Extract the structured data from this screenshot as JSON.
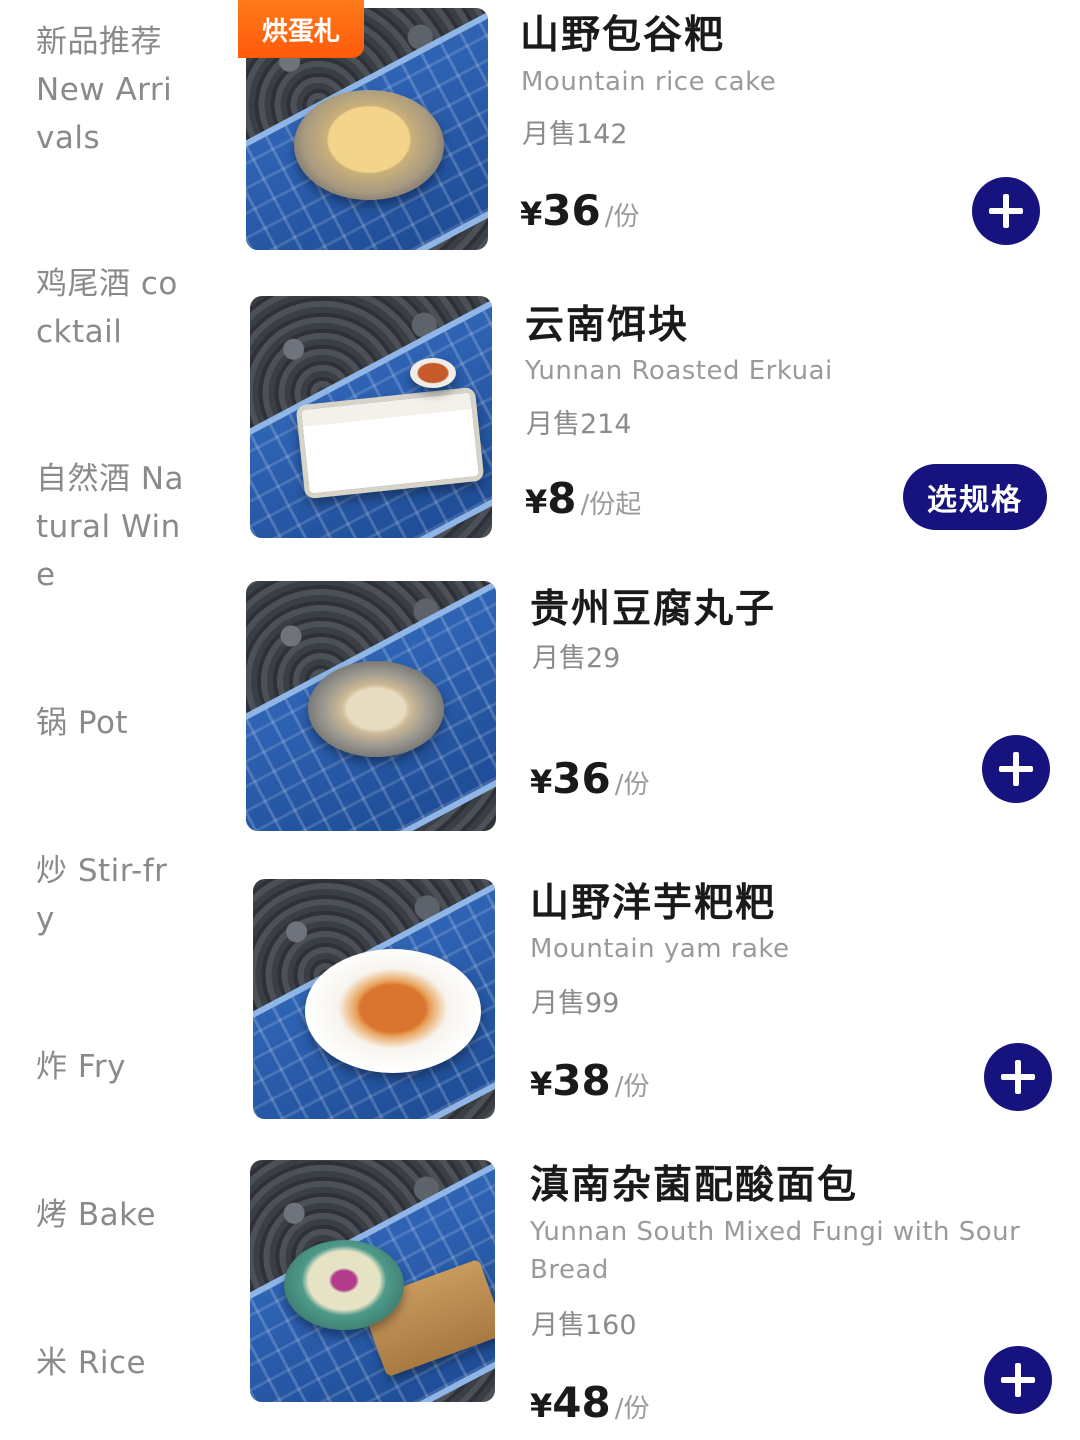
{
  "sidebar": {
    "categories": [
      {
        "label": "新品推荐 New Arrivals"
      },
      {
        "label": "鸡尾酒 cocktail"
      },
      {
        "label": "自然酒 Natural Wine"
      },
      {
        "label": "锅 Pot"
      },
      {
        "label": "炒 Stir-fry"
      },
      {
        "label": "炸 Fry"
      },
      {
        "label": "烤 Bake"
      },
      {
        "label": "米 Rice"
      }
    ]
  },
  "badge": {
    "label": "烘蛋札"
  },
  "items": [
    {
      "name": "山野包谷粑",
      "en": "Mountain rice cake",
      "sold": "月售142",
      "currency": "¥",
      "price": "36",
      "unit": "/份",
      "action": "add"
    },
    {
      "name": "云南饵块",
      "en": "Yunnan Roasted Erkuai",
      "sold": "月售214",
      "currency": "¥",
      "price": "8",
      "unit": "/份起",
      "action": "spec",
      "action_label": "选规格"
    },
    {
      "name": "贵州豆腐丸子",
      "en": "",
      "sold": "月售29",
      "currency": "¥",
      "price": "36",
      "unit": "/份",
      "action": "add"
    },
    {
      "name": "山野洋芋粑粑",
      "en": "Mountain yam rake",
      "sold": "月售99",
      "currency": "¥",
      "price": "38",
      "unit": "/份",
      "action": "add"
    },
    {
      "name": "滇南杂菌配酸面包",
      "en": "Yunnan South Mixed Fungi with Sour Bread",
      "sold": "月售160",
      "currency": "¥",
      "price": "48",
      "unit": "/份",
      "action": "add"
    }
  ]
}
